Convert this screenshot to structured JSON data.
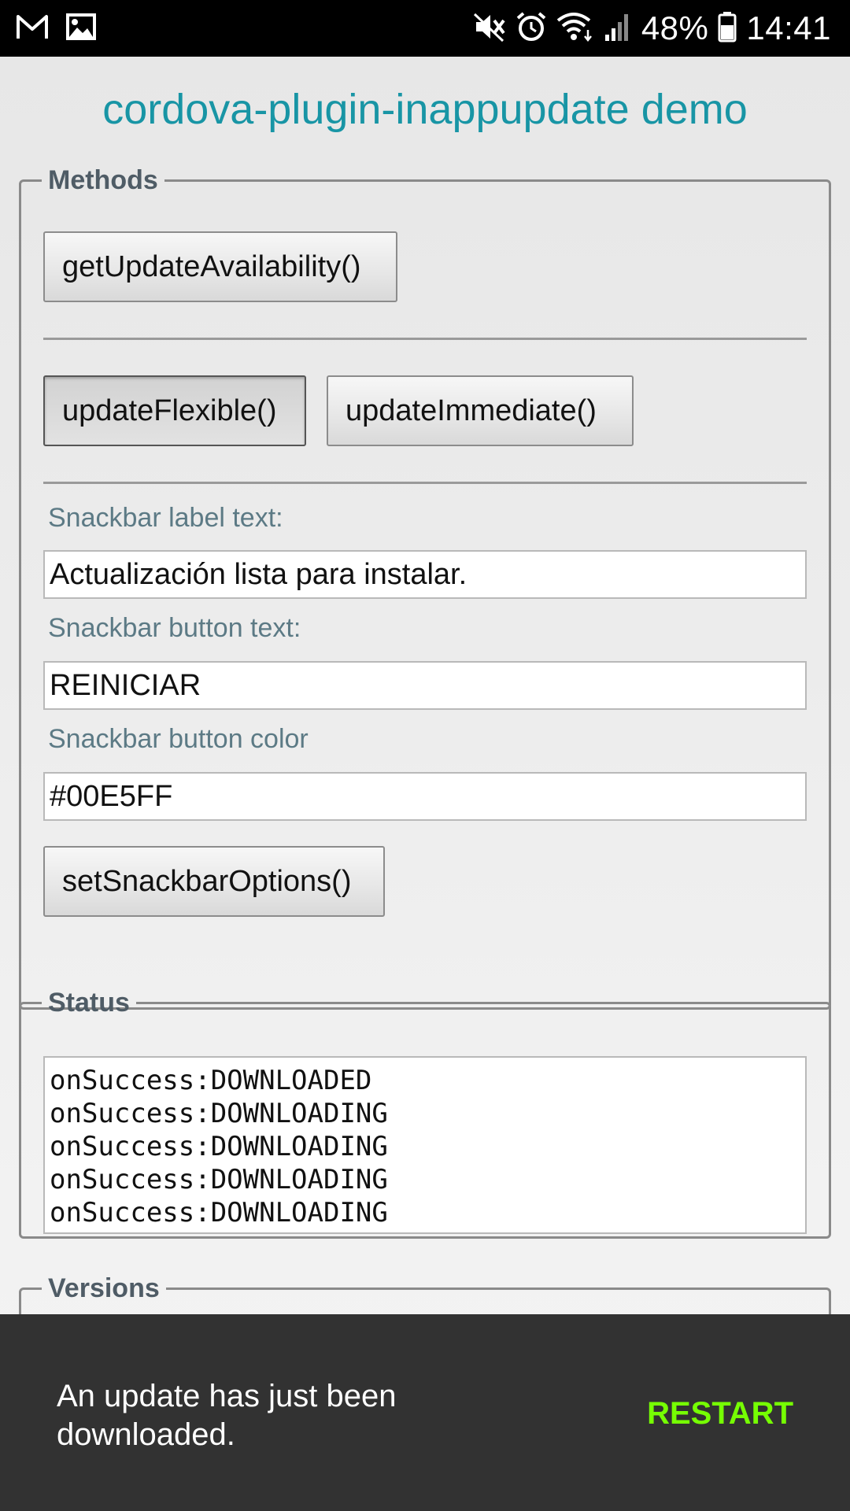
{
  "status_bar": {
    "left_icons": [
      "gmail-icon",
      "gallery-icon"
    ],
    "right_icons": [
      "mute-icon",
      "alarm-icon",
      "wifi-icon",
      "signal-icon",
      "battery-icon"
    ],
    "battery": "48%",
    "time": "14:41"
  },
  "app": {
    "title": "cordova-plugin-inappupdate demo"
  },
  "methods": {
    "legend": "Methods",
    "get_update_availability": "getUpdateAvailability()",
    "update_flexible": "updateFlexible()",
    "update_immediate": "updateImmediate()",
    "snackbar_label_caption": "Snackbar label text:",
    "snackbar_label_value": "Actualización lista para instalar.",
    "snackbar_button_caption": "Snackbar button text:",
    "snackbar_button_value": "REINICIAR",
    "snackbar_color_caption": "Snackbar button color",
    "snackbar_color_value": "#00E5FF",
    "set_snackbar_options": "setSnackbarOptions()"
  },
  "status": {
    "legend": "Status",
    "log": [
      "onSuccess:DOWNLOADED",
      "onSuccess:DOWNLOADING",
      "onSuccess:DOWNLOADING",
      "onSuccess:DOWNLOADING",
      "onSuccess:DOWNLOADING"
    ]
  },
  "versions": {
    "legend": "Versions"
  },
  "snackbar": {
    "message": "An update has just been downloaded.",
    "action": "RESTART",
    "action_color": "#76FF03",
    "background": "#323232"
  },
  "colors": {
    "title": "#1895A5",
    "legend": "#4F5C66",
    "field_label": "#5C7A85"
  }
}
